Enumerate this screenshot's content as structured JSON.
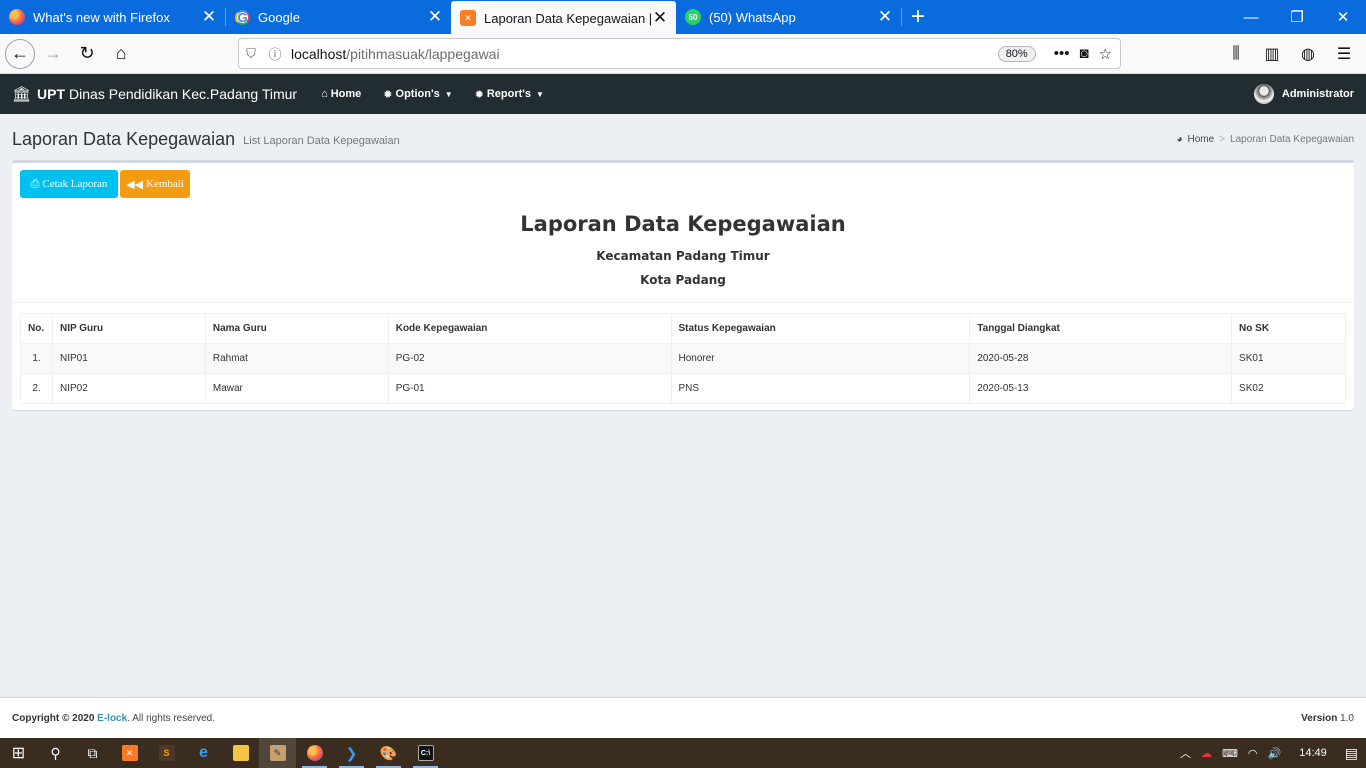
{
  "browser": {
    "tabs": [
      {
        "label": "What's new with Firefox",
        "icon": "firefox-icon",
        "active": false
      },
      {
        "label": "Google",
        "icon": "google-icon",
        "active": false
      },
      {
        "label": "Laporan Data Kepegawaian | E-",
        "icon": "xampp-icon",
        "active": true
      },
      {
        "label": "(50) WhatsApp",
        "icon": "whatsapp-icon",
        "active": false
      }
    ],
    "url_host": "localhost",
    "url_path": "/pitihmasuak/lappegawai",
    "zoom": "80%"
  },
  "header": {
    "brand_bold": "UPT",
    "brand_rest": "Dinas Pendidikan Kec.Padang Timur",
    "menu": {
      "home": "Home",
      "options": "Option's",
      "reports": "Report's"
    },
    "user_name": "Administrator"
  },
  "content_header": {
    "title": "Laporan Data Kepegawaian",
    "subtitle": "List Laporan Data Kepegawaian",
    "breadcrumb": {
      "home": "Home",
      "current": "Laporan Data Kepegawaian"
    }
  },
  "actions": {
    "print_label": "Cetak Laporan",
    "back_label": "Kembali"
  },
  "report": {
    "title": "Laporan Data Kepegawaian",
    "subtitle1": "Kecamatan Padang Timur",
    "subtitle2": "Kota Padang",
    "columns": [
      "No.",
      "NIP Guru",
      "Nama Guru",
      "Kode Kepegawaian",
      "Status Kepegawaian",
      "Tanggal Diangkat",
      "No SK"
    ],
    "rows": [
      [
        "1.",
        "NIP01",
        "Rahmat",
        "PG-02",
        "Honorer",
        "2020-05-28",
        "SK01"
      ],
      [
        "2.",
        "NIP02",
        "Mawar",
        "PG-01",
        "PNS",
        "2020-05-13",
        "SK02"
      ]
    ]
  },
  "footer": {
    "copyright_prefix": "Copyright © 2020",
    "brand": "E-lock",
    "rights": ". All rights reserved.",
    "version_label": "Version",
    "version_value": "1.0"
  },
  "taskbar": {
    "time": "14:49"
  },
  "colors": {
    "browser_tabstrip": "#0a6cdc",
    "app_header": "#222d32",
    "btn_info": "#00c0ef",
    "btn_warning": "#f39c12",
    "link": "#3c8dbc"
  }
}
